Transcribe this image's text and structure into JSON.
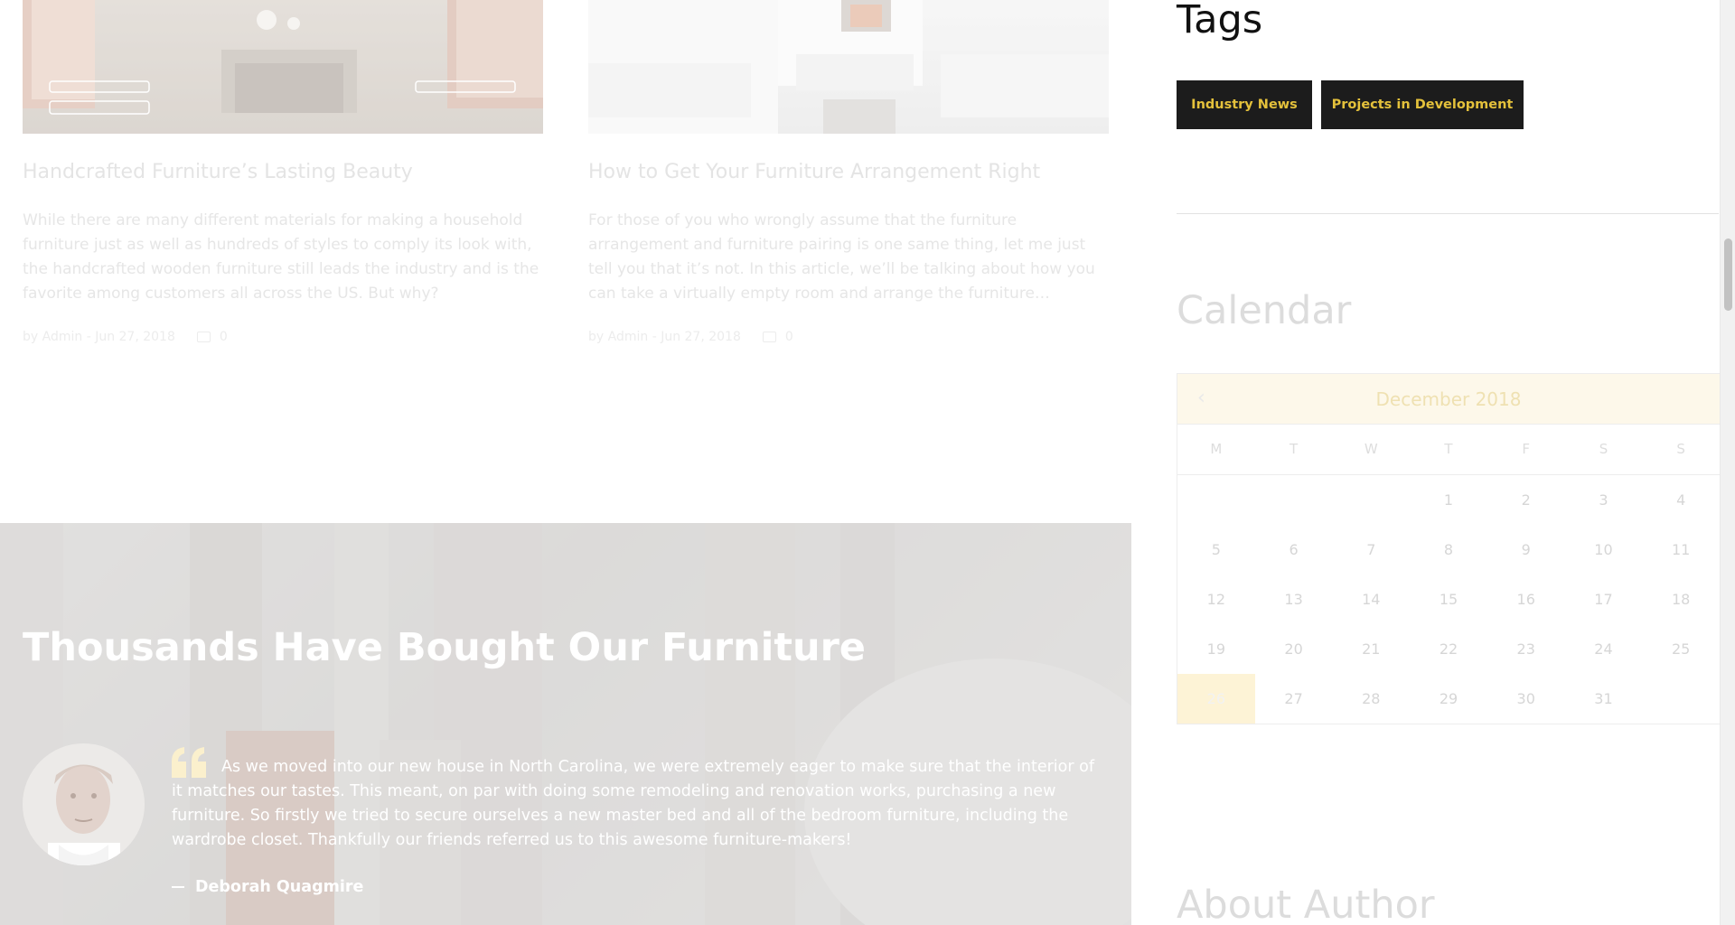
{
  "posts": [
    {
      "title": "Handcrafted Furniture’s Lasting Beauty",
      "excerpt": "While there are many different materials for making a household furniture just as well as hundreds of styles to comply its look with, the handcrafted wooden furniture still leads the industry and is the favorite among customers all across the US. But why?",
      "meta_by": "by Admin - Jun 27, 2018",
      "comments": "0"
    },
    {
      "title": "How to Get Your Furniture Arrangement Right",
      "excerpt": "For those of you who wrongly assume that the furniture arrangement and furniture pairing is one same thing, let me just tell you that it’s not. In this article, we’ll be talking about how you can take a virtually empty room and arrange the furniture…",
      "meta_by": "by Admin - Jun 27, 2018",
      "comments": "0"
    }
  ],
  "testimonial": {
    "heading": "Thousands Have Bought Our Furniture",
    "quote": "As we moved into our new house in North Carolina, we were extremely eager to make sure that the interior of it matches our tastes. This meant, on par with doing some remodeling and renovation works, purchasing a new furniture. So firstly we tried to secure ourselves a new master bed and all of the bedroom furniture, including the wardrobe closet. Thankfully our friends referred us to this awesome furniture-makers!",
    "author": "Deborah Quagmire"
  },
  "sidebar": {
    "tags_title": "Tags",
    "tags": [
      "Industry News",
      "Projects in Development"
    ],
    "calendar_title": "Calendar",
    "calendar": {
      "month": "December 2018",
      "prev": "‹",
      "days": [
        "M",
        "T",
        "W",
        "T",
        "F",
        "S",
        "S"
      ],
      "weeks": [
        [
          "",
          "",
          "",
          "1",
          "2",
          "3",
          "4"
        ],
        [
          "5",
          "6",
          "7",
          "8",
          "9",
          "10",
          "11"
        ],
        [
          "12",
          "13",
          "14",
          "15",
          "16",
          "17",
          "18"
        ],
        [
          "19",
          "20",
          "21",
          "22",
          "23",
          "24",
          "25"
        ],
        [
          "26",
          "27",
          "28",
          "29",
          "30",
          "31",
          ""
        ]
      ],
      "today": "26"
    },
    "about_title": "About Author"
  },
  "colors": {
    "tag_bg": "#1c1c1c",
    "tag_text": "#e4c13b",
    "accent_light": "#fdf3d6",
    "faded_text": "#e0e0e0"
  }
}
